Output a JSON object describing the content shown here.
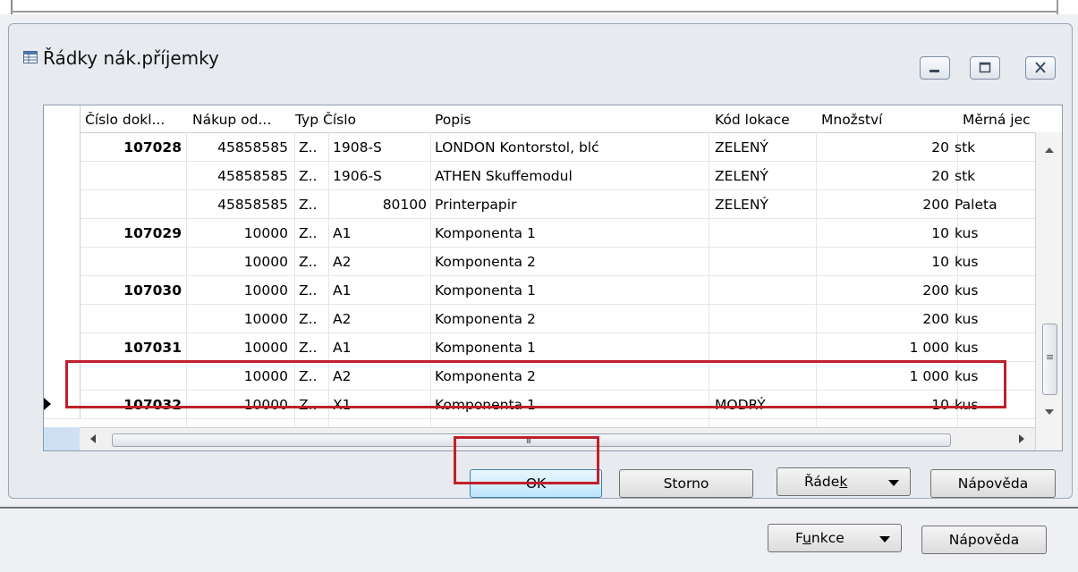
{
  "window": {
    "title": "Řádky nák.příjemky",
    "icon": "table-icon",
    "controls": [
      "minimize-icon",
      "maximize-icon",
      "close-icon"
    ]
  },
  "grid": {
    "columns": [
      {
        "key": "doc",
        "label": "Číslo dokl..."
      },
      {
        "key": "vendor",
        "label": "Nákup od..."
      },
      {
        "key": "type",
        "label": "Typ"
      },
      {
        "key": "no",
        "label": "Číslo"
      },
      {
        "key": "desc",
        "label": "Popis"
      },
      {
        "key": "loc",
        "label": "Kód lokace"
      },
      {
        "key": "qty",
        "label": "Množství"
      },
      {
        "key": "uom",
        "label": "Měrná jec"
      }
    ],
    "rows": [
      {
        "doc": "107028",
        "vendor": "45858585",
        "type": "Z..",
        "no": "1908-S",
        "desc": "LONDON Kontorstol, blć",
        "loc": "ZELENÝ",
        "qty": "20",
        "uom": "stk"
      },
      {
        "doc": "",
        "vendor": "45858585",
        "type": "Z..",
        "no": "1906-S",
        "desc": "ATHEN Skuffemodul",
        "loc": "ZELENÝ",
        "qty": "20",
        "uom": "stk"
      },
      {
        "doc": "",
        "vendor": "45858585",
        "type": "Z..",
        "no": "80100",
        "desc": "Printerpapir",
        "loc": "ZELENÝ",
        "qty": "200",
        "uom": "Paleta"
      },
      {
        "doc": "107029",
        "vendor": "10000",
        "type": "Z..",
        "no": "A1",
        "desc": "Komponenta 1",
        "loc": "",
        "qty": "10",
        "uom": "kus"
      },
      {
        "doc": "",
        "vendor": "10000",
        "type": "Z..",
        "no": "A2",
        "desc": "Komponenta 2",
        "loc": "",
        "qty": "10",
        "uom": "kus"
      },
      {
        "doc": "107030",
        "vendor": "10000",
        "type": "Z..",
        "no": "A1",
        "desc": "Komponenta 1",
        "loc": "",
        "qty": "200",
        "uom": "kus"
      },
      {
        "doc": "",
        "vendor": "10000",
        "type": "Z..",
        "no": "A2",
        "desc": "Komponenta 2",
        "loc": "",
        "qty": "200",
        "uom": "kus"
      },
      {
        "doc": "107031",
        "vendor": "10000",
        "type": "Z..",
        "no": "A1",
        "desc": "Komponenta 1",
        "loc": "",
        "qty": "1 000",
        "uom": "kus"
      },
      {
        "doc": "",
        "vendor": "10000",
        "type": "Z..",
        "no": "A2",
        "desc": "Komponenta 2",
        "loc": "",
        "qty": "1 000",
        "uom": "kus"
      },
      {
        "doc": "107032",
        "vendor": "10000",
        "type": "Z..",
        "no": "X1",
        "desc": "Komponenta 1",
        "loc": "MODRÝ",
        "qty": "10",
        "uom": "kus",
        "current": true
      }
    ],
    "hscroll_grip": "III",
    "vscroll_grip": "≡"
  },
  "buttons": {
    "ok": "OK",
    "storno": "Storno",
    "radek_pre": "Řáde",
    "radek_ul": "k",
    "napoveda": "Nápověda"
  },
  "footer": {
    "funkce_pre": "F",
    "funkce_ul": "u",
    "funkce_post": "nkce",
    "napoveda": "Nápověda"
  },
  "colors": {
    "highlight": "#c0202b",
    "default_button": "#bee6fd"
  }
}
